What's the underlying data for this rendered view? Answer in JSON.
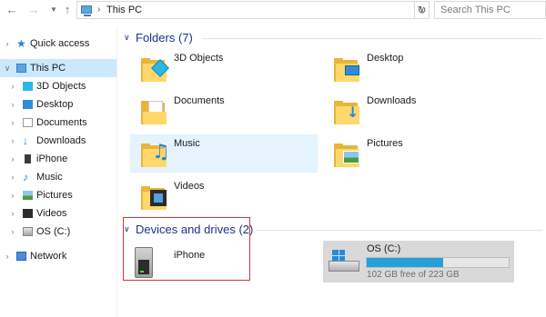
{
  "address_bar": {
    "back_icon": "arrow-left-icon",
    "forward_icon": "arrow-right-icon",
    "recent_icon": "chevron-down-icon",
    "up_icon": "arrow-up-icon",
    "crumb": "This PC",
    "search_placeholder": "Search This PC"
  },
  "sidebar": {
    "items": [
      {
        "label": "Quick access",
        "icon": "star-icon"
      },
      {
        "label": "This PC",
        "icon": "computer-icon"
      },
      {
        "label": "3D Objects",
        "icon": "cube-icon"
      },
      {
        "label": "Desktop",
        "icon": "desktop-icon"
      },
      {
        "label": "Documents",
        "icon": "documents-icon"
      },
      {
        "label": "Downloads",
        "icon": "download-icon"
      },
      {
        "label": "iPhone",
        "icon": "phone-device-icon"
      },
      {
        "label": "Music",
        "icon": "music-icon"
      },
      {
        "label": "Pictures",
        "icon": "pictures-icon"
      },
      {
        "label": "Videos",
        "icon": "video-icon"
      },
      {
        "label": "OS (C:)",
        "icon": "drive-icon"
      },
      {
        "label": "Network",
        "icon": "network-icon"
      }
    ]
  },
  "folders_group": {
    "title": "Folders (7)",
    "items": [
      {
        "label": "3D Objects"
      },
      {
        "label": "Desktop"
      },
      {
        "label": "Documents"
      },
      {
        "label": "Downloads"
      },
      {
        "label": "Music"
      },
      {
        "label": "Pictures"
      },
      {
        "label": "Videos"
      }
    ]
  },
  "devices_group": {
    "title": "Devices and drives (2)",
    "iphone_label": "iPhone",
    "drive": {
      "name": "OS (C:)",
      "free_text": "102 GB free of 223 GB",
      "used_fraction": 0.54
    }
  },
  "colors": {
    "accent": "#1e3287",
    "selection": "#cce8ff",
    "highlight_box": "#d73535",
    "drive_bar": "#26a0da"
  }
}
